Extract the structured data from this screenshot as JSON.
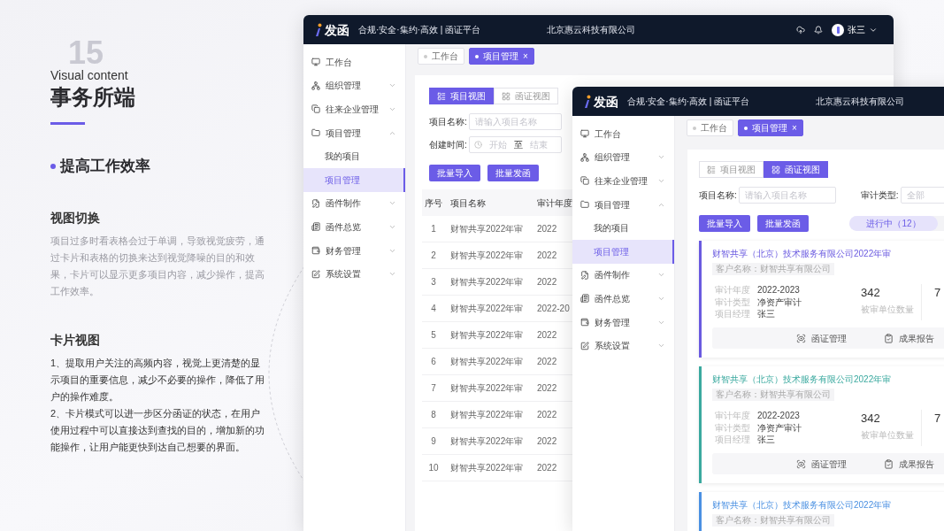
{
  "intro": {
    "decor_number": "15",
    "eyebrow": "Visual content",
    "title": "事务所端",
    "subtitle": "提高工作效率",
    "sections": [
      {
        "heading": "视图切换",
        "kind": "muted",
        "paragraphs": [
          "项目过多时看表格会过于单调，导致视觉疲劳，通过卡片和表格的切换来达到视觉降噪的目的和效果，卡片可以显示更多项目内容，减少操作，提高工作效率。"
        ]
      },
      {
        "heading": "卡片视图",
        "kind": "normal",
        "paragraphs": [
          "1、提取用户关注的高频内容，视觉上更清楚的显示项目的重要信息，减少不必要的操作，降低了用户的操作难度。",
          "2、卡片模式可以进一步区分函证的状态，在用户使用过程中可以直接达到查找的目的，增加新的功能操作，让用户能更快到达自己想要的界面。"
        ]
      }
    ]
  },
  "windows": [
    {
      "header": {
        "logo": "发函",
        "slogan": "合规·安全·集约·高效 | 函证平台",
        "company": "北京惠云科技有限公司",
        "user": "张三"
      },
      "sidebar": [
        {
          "label": "工作台",
          "kind": "link"
        },
        {
          "label": "组织管理",
          "kind": "group",
          "expanded": false
        },
        {
          "label": "往来企业管理",
          "kind": "group",
          "expanded": false
        },
        {
          "label": "项目管理",
          "kind": "group",
          "expanded": true,
          "children": [
            {
              "label": "我的项目",
              "selected": false
            },
            {
              "label": "项目管理",
              "selected": true
            }
          ]
        },
        {
          "label": "函件制作",
          "kind": "group",
          "expanded": false
        },
        {
          "label": "函件总览",
          "kind": "group",
          "expanded": false
        },
        {
          "label": "财务管理",
          "kind": "group",
          "expanded": false
        },
        {
          "label": "系统设置",
          "kind": "group",
          "expanded": false
        }
      ],
      "tabs": [
        {
          "label": "工作台",
          "selected": false
        },
        {
          "label": "项目管理",
          "selected": true,
          "close": "×"
        }
      ],
      "views": [
        {
          "label": "项目视图",
          "selected": true
        },
        {
          "label": "函证视图",
          "selected": false
        }
      ],
      "filters": [
        {
          "kind": "text",
          "label": "项目名称:",
          "placeholder": "请输入项目名称"
        },
        {
          "kind": "range",
          "label": "创建时间:",
          "start_placeholder": "开始",
          "separator": "至",
          "end_placeholder": "结束"
        }
      ],
      "actions": [
        "批量导入",
        "批量发函"
      ],
      "content": {
        "kind": "table",
        "columns": [
          "序号",
          "项目名称",
          "审计年度"
        ],
        "rows": [
          {
            "index": "1",
            "name": "财智共享2022年审",
            "year": "2022"
          },
          {
            "index": "2",
            "name": "财智共享2022年审",
            "year": "2022"
          },
          {
            "index": "3",
            "name": "财智共享2022年审",
            "year": "2022"
          },
          {
            "index": "4",
            "name": "财智共享2022年审",
            "year": "2022-20"
          },
          {
            "index": "5",
            "name": "财智共享2022年审",
            "year": "2022"
          },
          {
            "index": "6",
            "name": "财智共享2022年审",
            "year": "2022"
          },
          {
            "index": "7",
            "name": "财智共享2022年审",
            "year": "2022"
          },
          {
            "index": "8",
            "name": "财智共享2022年审",
            "year": "2022"
          },
          {
            "index": "9",
            "name": "财智共享2022年审",
            "year": "2022"
          },
          {
            "index": "10",
            "name": "财智共享2022年审",
            "year": "2022"
          }
        ]
      }
    },
    {
      "header": {
        "logo": "发函",
        "slogan": "合规·安全·集约·高效 | 函证平台",
        "company": "北京惠云科技有限公司"
      },
      "sidebar": [
        {
          "label": "工作台",
          "kind": "link"
        },
        {
          "label": "组织管理",
          "kind": "group",
          "expanded": false
        },
        {
          "label": "往来企业管理",
          "kind": "group",
          "expanded": false
        },
        {
          "label": "项目管理",
          "kind": "group",
          "expanded": true,
          "children": [
            {
              "label": "我的项目",
              "selected": false
            },
            {
              "label": "项目管理",
              "selected": true
            }
          ]
        },
        {
          "label": "函件制作",
          "kind": "group",
          "expanded": false
        },
        {
          "label": "函件总览",
          "kind": "group",
          "expanded": false
        },
        {
          "label": "财务管理",
          "kind": "group",
          "expanded": false
        },
        {
          "label": "系统设置",
          "kind": "group",
          "expanded": false
        }
      ],
      "tabs": [
        {
          "label": "工作台",
          "selected": false
        },
        {
          "label": "项目管理",
          "selected": true,
          "close": "×"
        }
      ],
      "views": [
        {
          "label": "项目视图",
          "selected": false
        },
        {
          "label": "函证视图",
          "selected": true
        }
      ],
      "filters": [
        {
          "kind": "text",
          "label": "项目名称:",
          "placeholder": "请输入项目名称"
        },
        {
          "kind": "select",
          "label": "审计类型:",
          "placeholder": "全部"
        }
      ],
      "actions": [
        "批量导入",
        "批量发函"
      ],
      "status_tabs": [
        {
          "label": "进行中（12）",
          "selected": true
        }
      ],
      "content": {
        "kind": "cards",
        "cards": [
          {
            "title": "财智共享（北京）技术服务有限公司2022年审",
            "color": "#6a5ae0",
            "customer": "客户名称：财智共享有限公司",
            "details": [
              {
                "label": "审计年度",
                "value": "2022-2023"
              },
              {
                "label": "审计类型",
                "value": "净资产审计"
              },
              {
                "label": "项目经理",
                "value": "张三"
              }
            ],
            "stats": [
              {
                "value": "342",
                "label": "被审单位数量"
              },
              {
                "value": "7"
              }
            ],
            "actions": [
              "函证管理",
              "成果报告"
            ]
          },
          {
            "title": "财智共享（北京）技术服务有限公司2022年审",
            "color": "#3aa99f",
            "customer": "客户名称：财智共享有限公司",
            "details": [
              {
                "label": "审计年度",
                "value": "2022-2023"
              },
              {
                "label": "审计类型",
                "value": "净资产审计"
              },
              {
                "label": "项目经理",
                "value": "张三"
              }
            ],
            "stats": [
              {
                "value": "342",
                "label": "被审单位数量"
              },
              {
                "value": "7"
              }
            ],
            "actions": [
              "函证管理",
              "成果报告"
            ]
          },
          {
            "title": "财智共享（北京）技术服务有限公司2022年审",
            "color": "#4a90e2",
            "customer": "客户名称：财智共享有限公司"
          }
        ]
      }
    }
  ]
}
